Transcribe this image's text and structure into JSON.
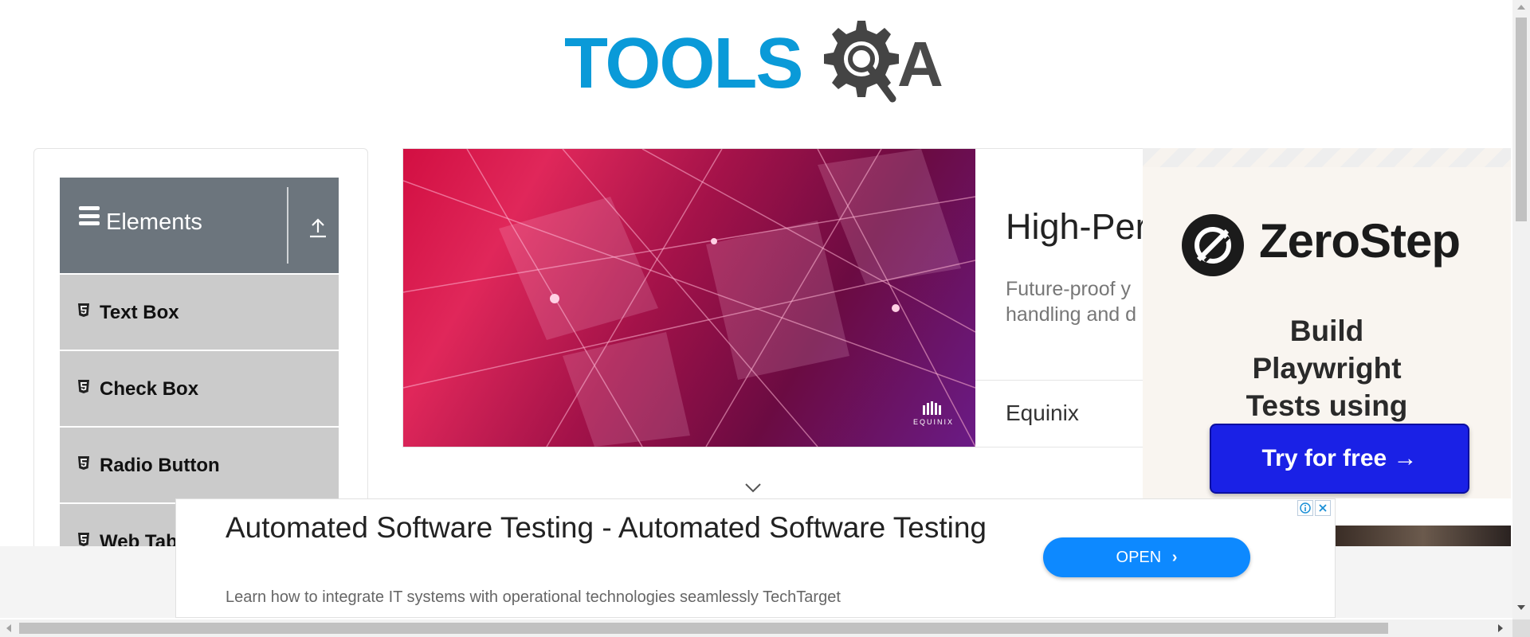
{
  "header": {
    "logo_text": "TOOLSQA",
    "logo_part1": "TOOLS",
    "logo_part2": "A"
  },
  "sidebar": {
    "group_title": "Elements",
    "items": [
      {
        "label": "Text Box"
      },
      {
        "label": "Check Box"
      },
      {
        "label": "Radio Button"
      },
      {
        "label": "Web Tab"
      }
    ]
  },
  "ad_card": {
    "headline": "High-Per",
    "description": "Future-proof y\nhandling and d",
    "brand": "Equinix",
    "image_watermark": "EQUINIX"
  },
  "zerostep_ad": {
    "brand": "ZeroStep",
    "tagline": "Build Playwright Tests using AI",
    "cta": "Try for free →"
  },
  "bottom_ad": {
    "title": "Automated Software Testing - Automated Software Testing",
    "subtitle": "Learn how to integrate IT systems with operational technologies seamlessly TechTarget",
    "button": "OPEN"
  },
  "colors": {
    "logo_blue": "#0a9ad8",
    "logo_gray": "#4a4a4a",
    "sidebar_header": "#6c757d",
    "sidebar_item": "#cbcbcb",
    "cta_blue": "#1a21e6",
    "open_blue": "#0d89ff"
  }
}
